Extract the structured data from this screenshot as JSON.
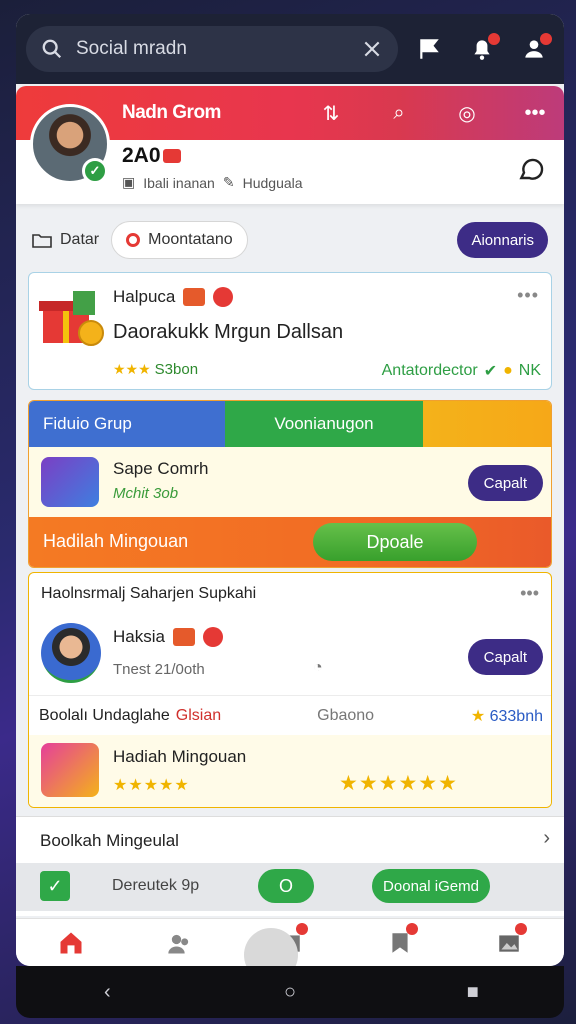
{
  "search": {
    "placeholder": "Social mradn"
  },
  "profile": {
    "name": "Nadn Grom",
    "count": "2A0",
    "meta_left": "Ibali inanan",
    "meta_right": "Hudguala"
  },
  "tabs": {
    "plain": "Datar",
    "pill": "Moontatano",
    "cta": "Aionnaris"
  },
  "card1": {
    "title": "Halpuca",
    "headline": "Daorakukk Mrgun Dallsan",
    "stars_label": "S3bon",
    "status": "Antatordector",
    "status_suffix": "NK"
  },
  "card2": {
    "tab1": "Fiduio Grup",
    "tab2": "Voonianugon",
    "item_title": "Sape Comrh",
    "item_sub": "Mchit 3ob",
    "item_button": "Capalt",
    "bottom_title": "Hadilah Mingouan",
    "bottom_button": "Dpoale"
  },
  "card3": {
    "header": "Haolnsrmalj Saharjen Supkahi",
    "title": "Haksia",
    "meta": "Tnest 21/0oth",
    "button": "Capalt",
    "row_label": "Boolalı Undaglahe",
    "row_red": "Glsian",
    "row_gray": "Gbaono",
    "row_blue": "633bnh",
    "bottom_title": "Hadiah Mingouan",
    "stars_small": "★★★★★",
    "stars_big": "★★★★★★"
  },
  "card4": {
    "title": "Boolkah Mingeulal",
    "label": "Dereutek 9p",
    "toggle": "O",
    "button": "Doonal iGemd"
  },
  "colors": {
    "brand_red": "#ee3b3b",
    "purple": "#3d2c86",
    "green": "#2fa848",
    "orange": "#f47a23",
    "blue": "#3f6fd0"
  },
  "icons": {
    "search": "search-icon",
    "close": "close-icon",
    "flag": "flag-icon",
    "notifications": "bell-icon",
    "profile_action": "chat-icon",
    "home": "home-icon"
  }
}
